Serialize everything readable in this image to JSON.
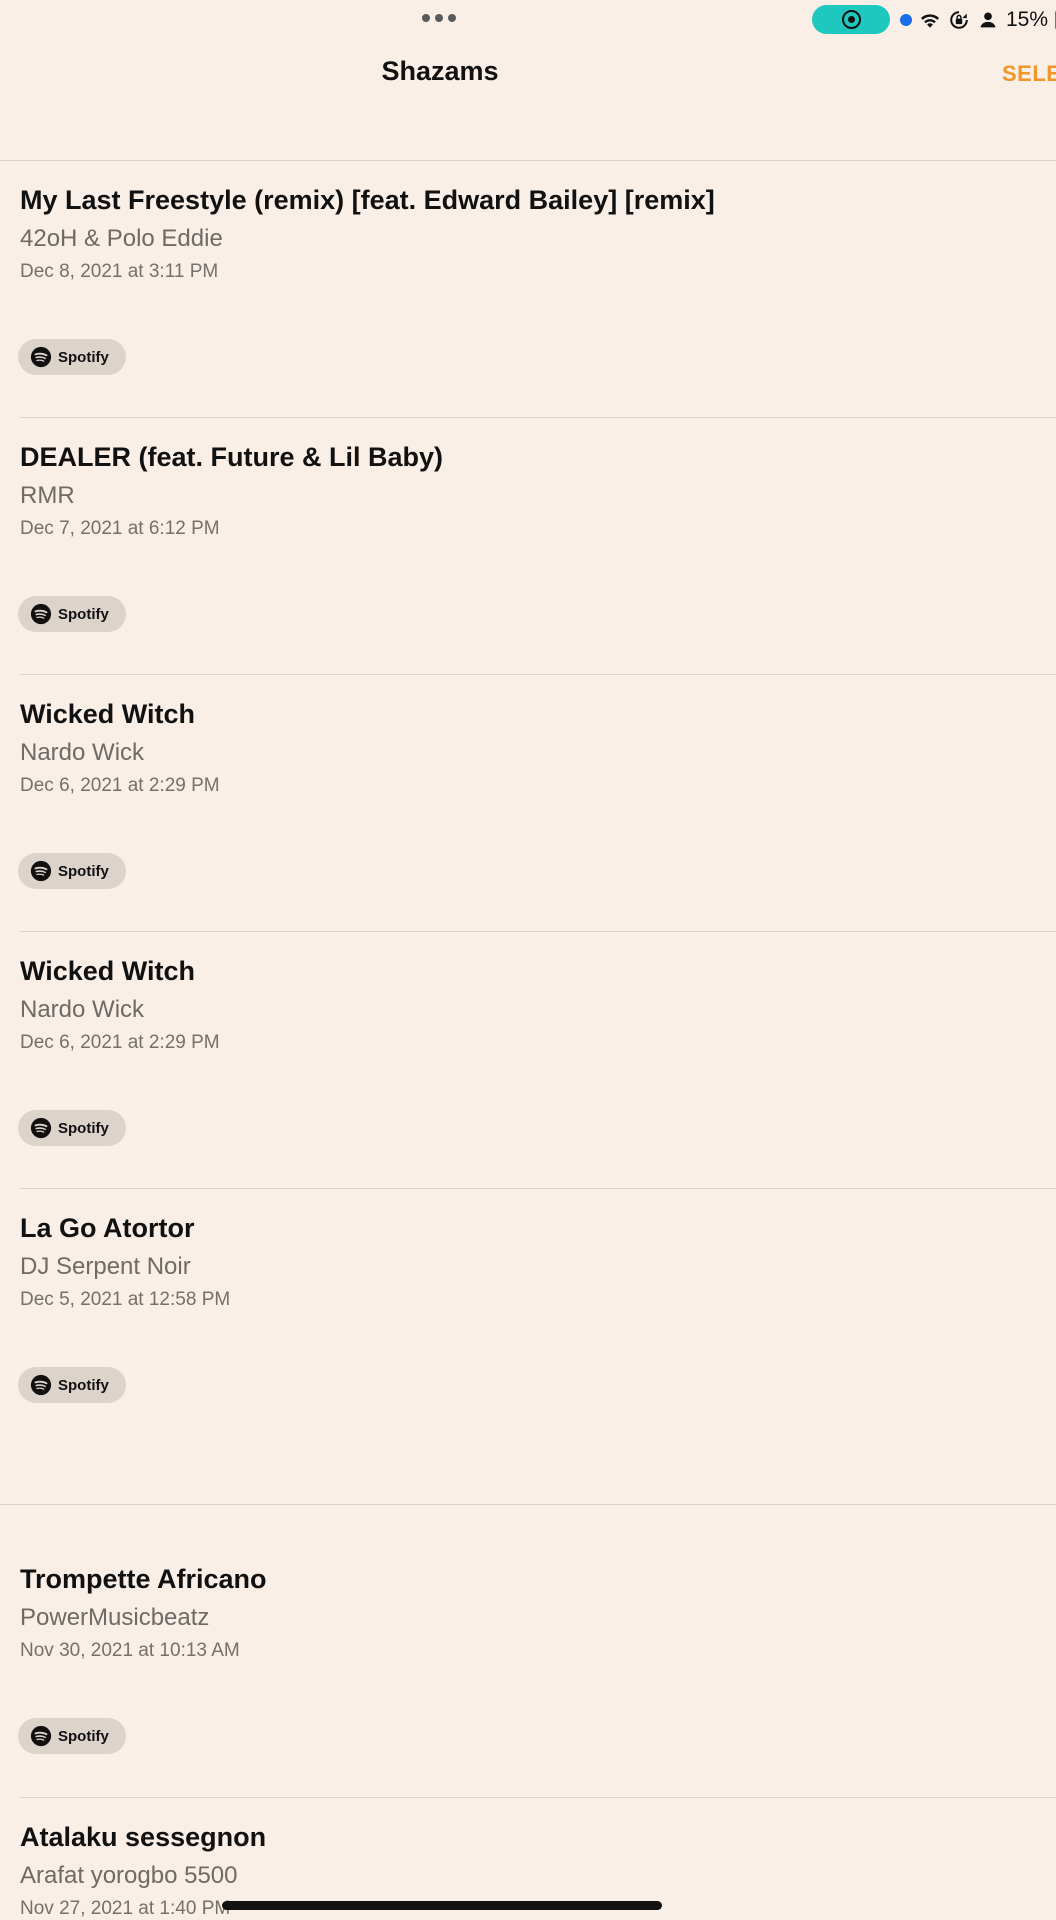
{
  "app": {
    "title": "Shazams",
    "select_label": "SELE"
  },
  "status_bar": {
    "battery": "15%",
    "icons": [
      "location-dot-icon",
      "wifi-icon",
      "orientation-lock-icon",
      "person-icon",
      "battery-icon",
      "screen-record-icon"
    ]
  },
  "colors": {
    "background": "#f9efe6",
    "accent": "#f0962a",
    "record_pill": "#1ec8be"
  },
  "items": [
    {
      "title": "My Last Freestyle (remix) [feat. Edward Bailey] [remix]",
      "artist": "42oH & Polo Eddie",
      "date": "Dec 8, 2021 at 3:11 PM",
      "service": "Spotify"
    },
    {
      "title": "DEALER (feat. Future & Lil Baby)",
      "artist": "RMR",
      "date": "Dec 7, 2021 at 6:12 PM",
      "service": "Spotify"
    },
    {
      "title": "Wicked Witch",
      "artist": "Nardo Wick",
      "date": "Dec 6, 2021 at 2:29 PM",
      "service": "Spotify"
    },
    {
      "title": "Wicked Witch",
      "artist": "Nardo Wick",
      "date": "Dec 6, 2021 at 2:29 PM",
      "service": "Spotify"
    },
    {
      "title": "La Go Atortor",
      "artist": "DJ Serpent Noir",
      "date": "Dec 5, 2021 at 12:58 PM",
      "service": "Spotify"
    },
    {
      "title": "Trompette Africano",
      "artist": "PowerMusicbeatz",
      "date": "Nov 30, 2021 at 10:13 AM",
      "service": "Spotify"
    },
    {
      "title": "Atalaku sessegnon",
      "artist": "Arafat yorogbo 5500",
      "date": "Nov 27, 2021 at 1:40 PM",
      "service": "Spotify"
    }
  ]
}
